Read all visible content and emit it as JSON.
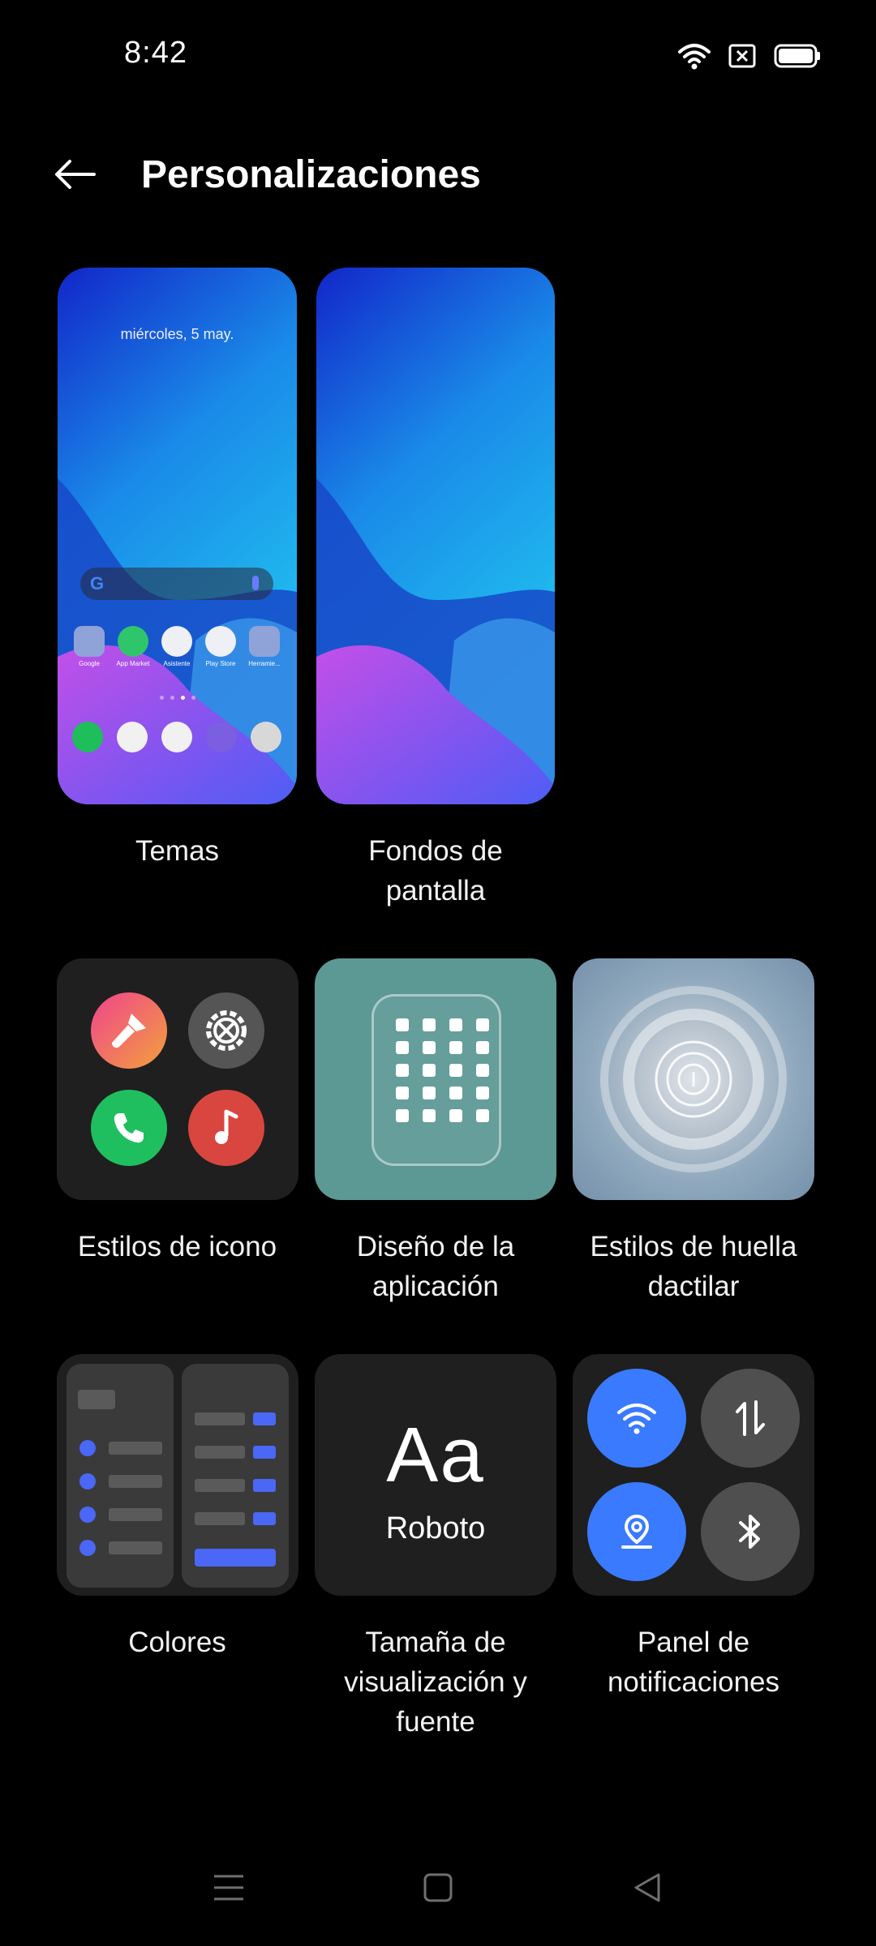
{
  "status": {
    "time": "8:42"
  },
  "header": {
    "title": "Personalizaciones"
  },
  "preview": {
    "date": "miércoles, 5 may.",
    "apps": [
      "Google",
      "App Market",
      "Asistente",
      "Play Store",
      "Herramie..."
    ]
  },
  "items": {
    "temas": "Temas",
    "fondos": "Fondos de\npantalla",
    "iconos": "Estilos de icono",
    "diseno": "Diseño de la\naplicación",
    "huella": "Estilos de huella\ndactilar",
    "colores": "Colores",
    "fuente": "Tamaña de\nvisualización y\nfuente",
    "panel": "Panel de\nnotificaciones"
  },
  "font_preview": {
    "sample": "Aa",
    "font_name": "Roboto"
  },
  "colors": {
    "background": "#000000",
    "accent_blue": "#3a7afe",
    "icon_tile": "#1f1f1f",
    "teal_tile": "#5c9894"
  }
}
